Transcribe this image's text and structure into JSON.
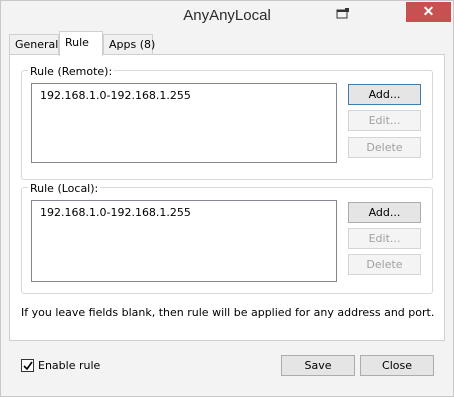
{
  "window": {
    "title": "AnyAnyLocal",
    "close_glyph": "✕"
  },
  "tabs": [
    {
      "label": "General"
    },
    {
      "label": "Rule"
    },
    {
      "label": "Apps (8)"
    }
  ],
  "rule_remote": {
    "label": "Rule (Remote):",
    "items": [
      "192.168.1.0-192.168.1.255"
    ],
    "add_label": "Add...",
    "edit_label": "Edit...",
    "delete_label": "Delete"
  },
  "rule_local": {
    "label": "Rule (Local):",
    "items": [
      "192.168.1.0-192.168.1.255"
    ],
    "add_label": "Add...",
    "edit_label": "Edit...",
    "delete_label": "Delete"
  },
  "note": "If you leave fields blank, then rule will be applied for any address and port.",
  "footer": {
    "enable_label": "Enable rule",
    "enable_checked": true,
    "save_label": "Save",
    "close_label": "Close"
  },
  "icons": {
    "restore": "restore-icon",
    "close": "close-icon",
    "check": "checkmark-icon"
  },
  "colors": {
    "close_button": "#c75050",
    "default_button_border": "#3c7fb1"
  }
}
